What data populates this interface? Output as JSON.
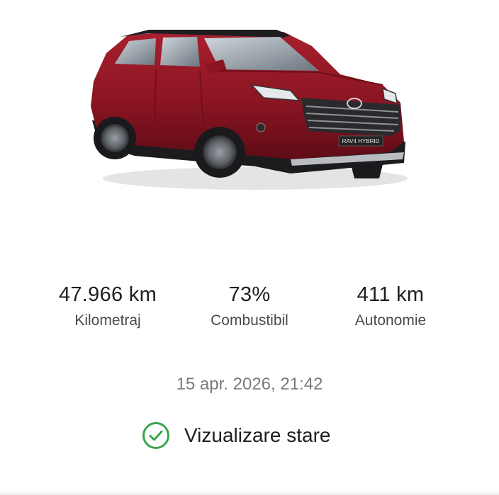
{
  "vehicle": {
    "model_badge": "RAV4 HYBRID",
    "body_color": "#8b1522"
  },
  "stats": {
    "mileage": {
      "value": "47.966 km",
      "label": "Kilometraj"
    },
    "fuel": {
      "value": "73%",
      "label": "Combustibil"
    },
    "range": {
      "value": "411 km",
      "label": "Autonomie"
    }
  },
  "last_update": "15 apr. 2026, 21:42",
  "status_link": {
    "label": "Vizualizare stare",
    "icon": "check-circle-icon",
    "icon_color": "#3aa34a"
  }
}
